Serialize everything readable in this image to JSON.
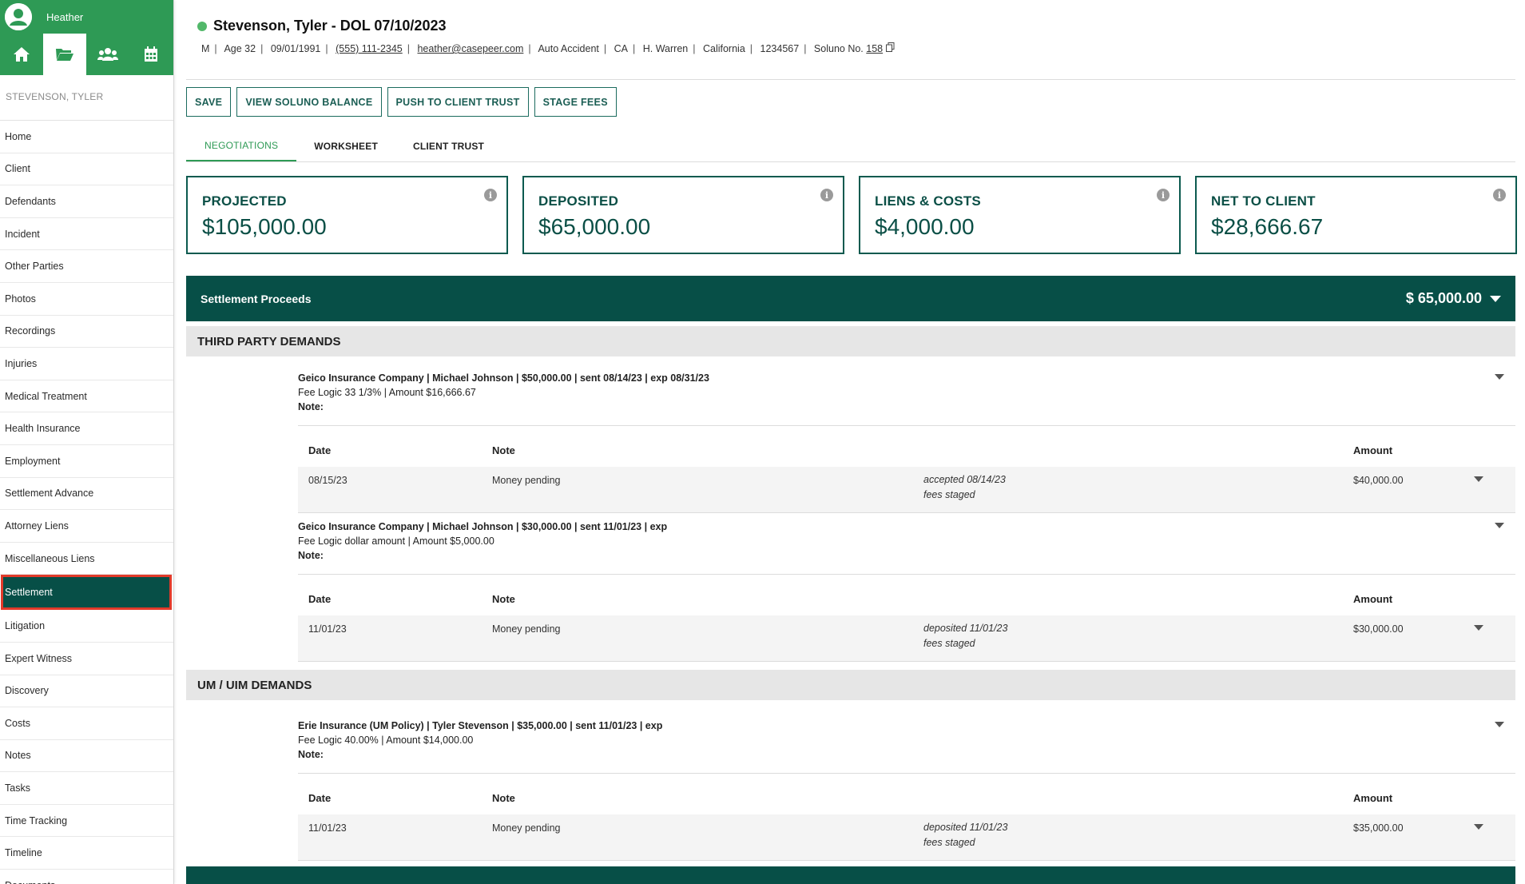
{
  "user": {
    "name": "Heather"
  },
  "nav_icons": [
    "home-icon",
    "folder-icon",
    "users-icon",
    "calendar-icon"
  ],
  "sidebar": {
    "patient": "STEVENSON, TYLER",
    "items": [
      "Home",
      "Client",
      "Defendants",
      "Incident",
      "Other Parties",
      "Photos",
      "Recordings",
      "Injuries",
      "Medical Treatment",
      "Health Insurance",
      "Employment",
      "Settlement Advance",
      "Attorney Liens",
      "Miscellaneous Liens",
      "Settlement",
      "Litigation",
      "Expert Witness",
      "Discovery",
      "Costs",
      "Notes",
      "Tasks",
      "Time Tracking",
      "Timeline",
      "Documents"
    ],
    "active": "Settlement"
  },
  "case": {
    "title": "Stevenson, Tyler - DOL 07/10/2023",
    "status_color": "#52b86a",
    "meta": {
      "sex": "M",
      "age": "Age 32",
      "dob": "09/01/1991",
      "phone": "(555) 111-2345",
      "email": "heather@casepeer.com",
      "type": "Auto Accident",
      "state": "CA",
      "attorney": "H. Warren",
      "location": "California",
      "number": "1234567",
      "soluno_label": "Soluno No.",
      "soluno_no": "158"
    }
  },
  "toolbar": {
    "save": "SAVE",
    "view_balance": "VIEW SOLUNO BALANCE",
    "push_trust": "PUSH TO CLIENT TRUST",
    "stage_fees": "STAGE FEES"
  },
  "tabs": {
    "negotiations": "NEGOTIATIONS",
    "worksheet": "WORKSHEET",
    "client_trust": "CLIENT TRUST"
  },
  "cards": {
    "projected": {
      "label": "PROJECTED",
      "value": "$105,000.00"
    },
    "deposited": {
      "label": "DEPOSITED",
      "value": "$65,000.00"
    },
    "liens": {
      "label": "LIENS & COSTS",
      "value": "$4,000.00"
    },
    "net": {
      "label": "NET TO CLIENT",
      "value": "$28,666.67"
    }
  },
  "proceeds": {
    "title": "Settlement Proceeds",
    "amount": "$ 65,000.00"
  },
  "table_headers": {
    "date": "Date",
    "note": "Note",
    "amount": "Amount"
  },
  "sections": {
    "third_party": "THIRD PARTY DEMANDS",
    "um_uim": "UM / UIM DEMANDS"
  },
  "demands": [
    {
      "summary": "Geico Insurance Company | Michael Johnson | $50,000.00 | sent 08/14/23 | exp 08/31/23",
      "fee": "Fee Logic 33 1/3% | Amount $16,666.67",
      "note_label": "Note:",
      "row": {
        "date": "08/15/23",
        "note": "Money pending",
        "status1": "accepted 08/14/23",
        "status2": "fees staged",
        "amount": "$40,000.00"
      }
    },
    {
      "summary": "Geico Insurance Company | Michael Johnson | $30,000.00 | sent 11/01/23 | exp",
      "fee": "Fee Logic dollar amount | Amount $5,000.00",
      "note_label": "Note:",
      "row": {
        "date": "11/01/23",
        "note": "Money pending",
        "status1": "deposited 11/01/23",
        "status2": "fees staged",
        "amount": "$30,000.00"
      }
    },
    {
      "summary": "Erie Insurance (UM Policy) | Tyler Stevenson | $35,000.00 | sent 11/01/23 | exp",
      "fee": "Fee Logic 40.00% | Amount $14,000.00",
      "note_label": "Note:",
      "row": {
        "date": "11/01/23",
        "note": "Money pending",
        "status1": "deposited 11/01/23",
        "status2": "fees staged",
        "amount": "$35,000.00"
      }
    }
  ],
  "colors": {
    "brand_green": "#2e9a55",
    "dark_teal": "#074f47",
    "highlight": "#e23a2a"
  }
}
